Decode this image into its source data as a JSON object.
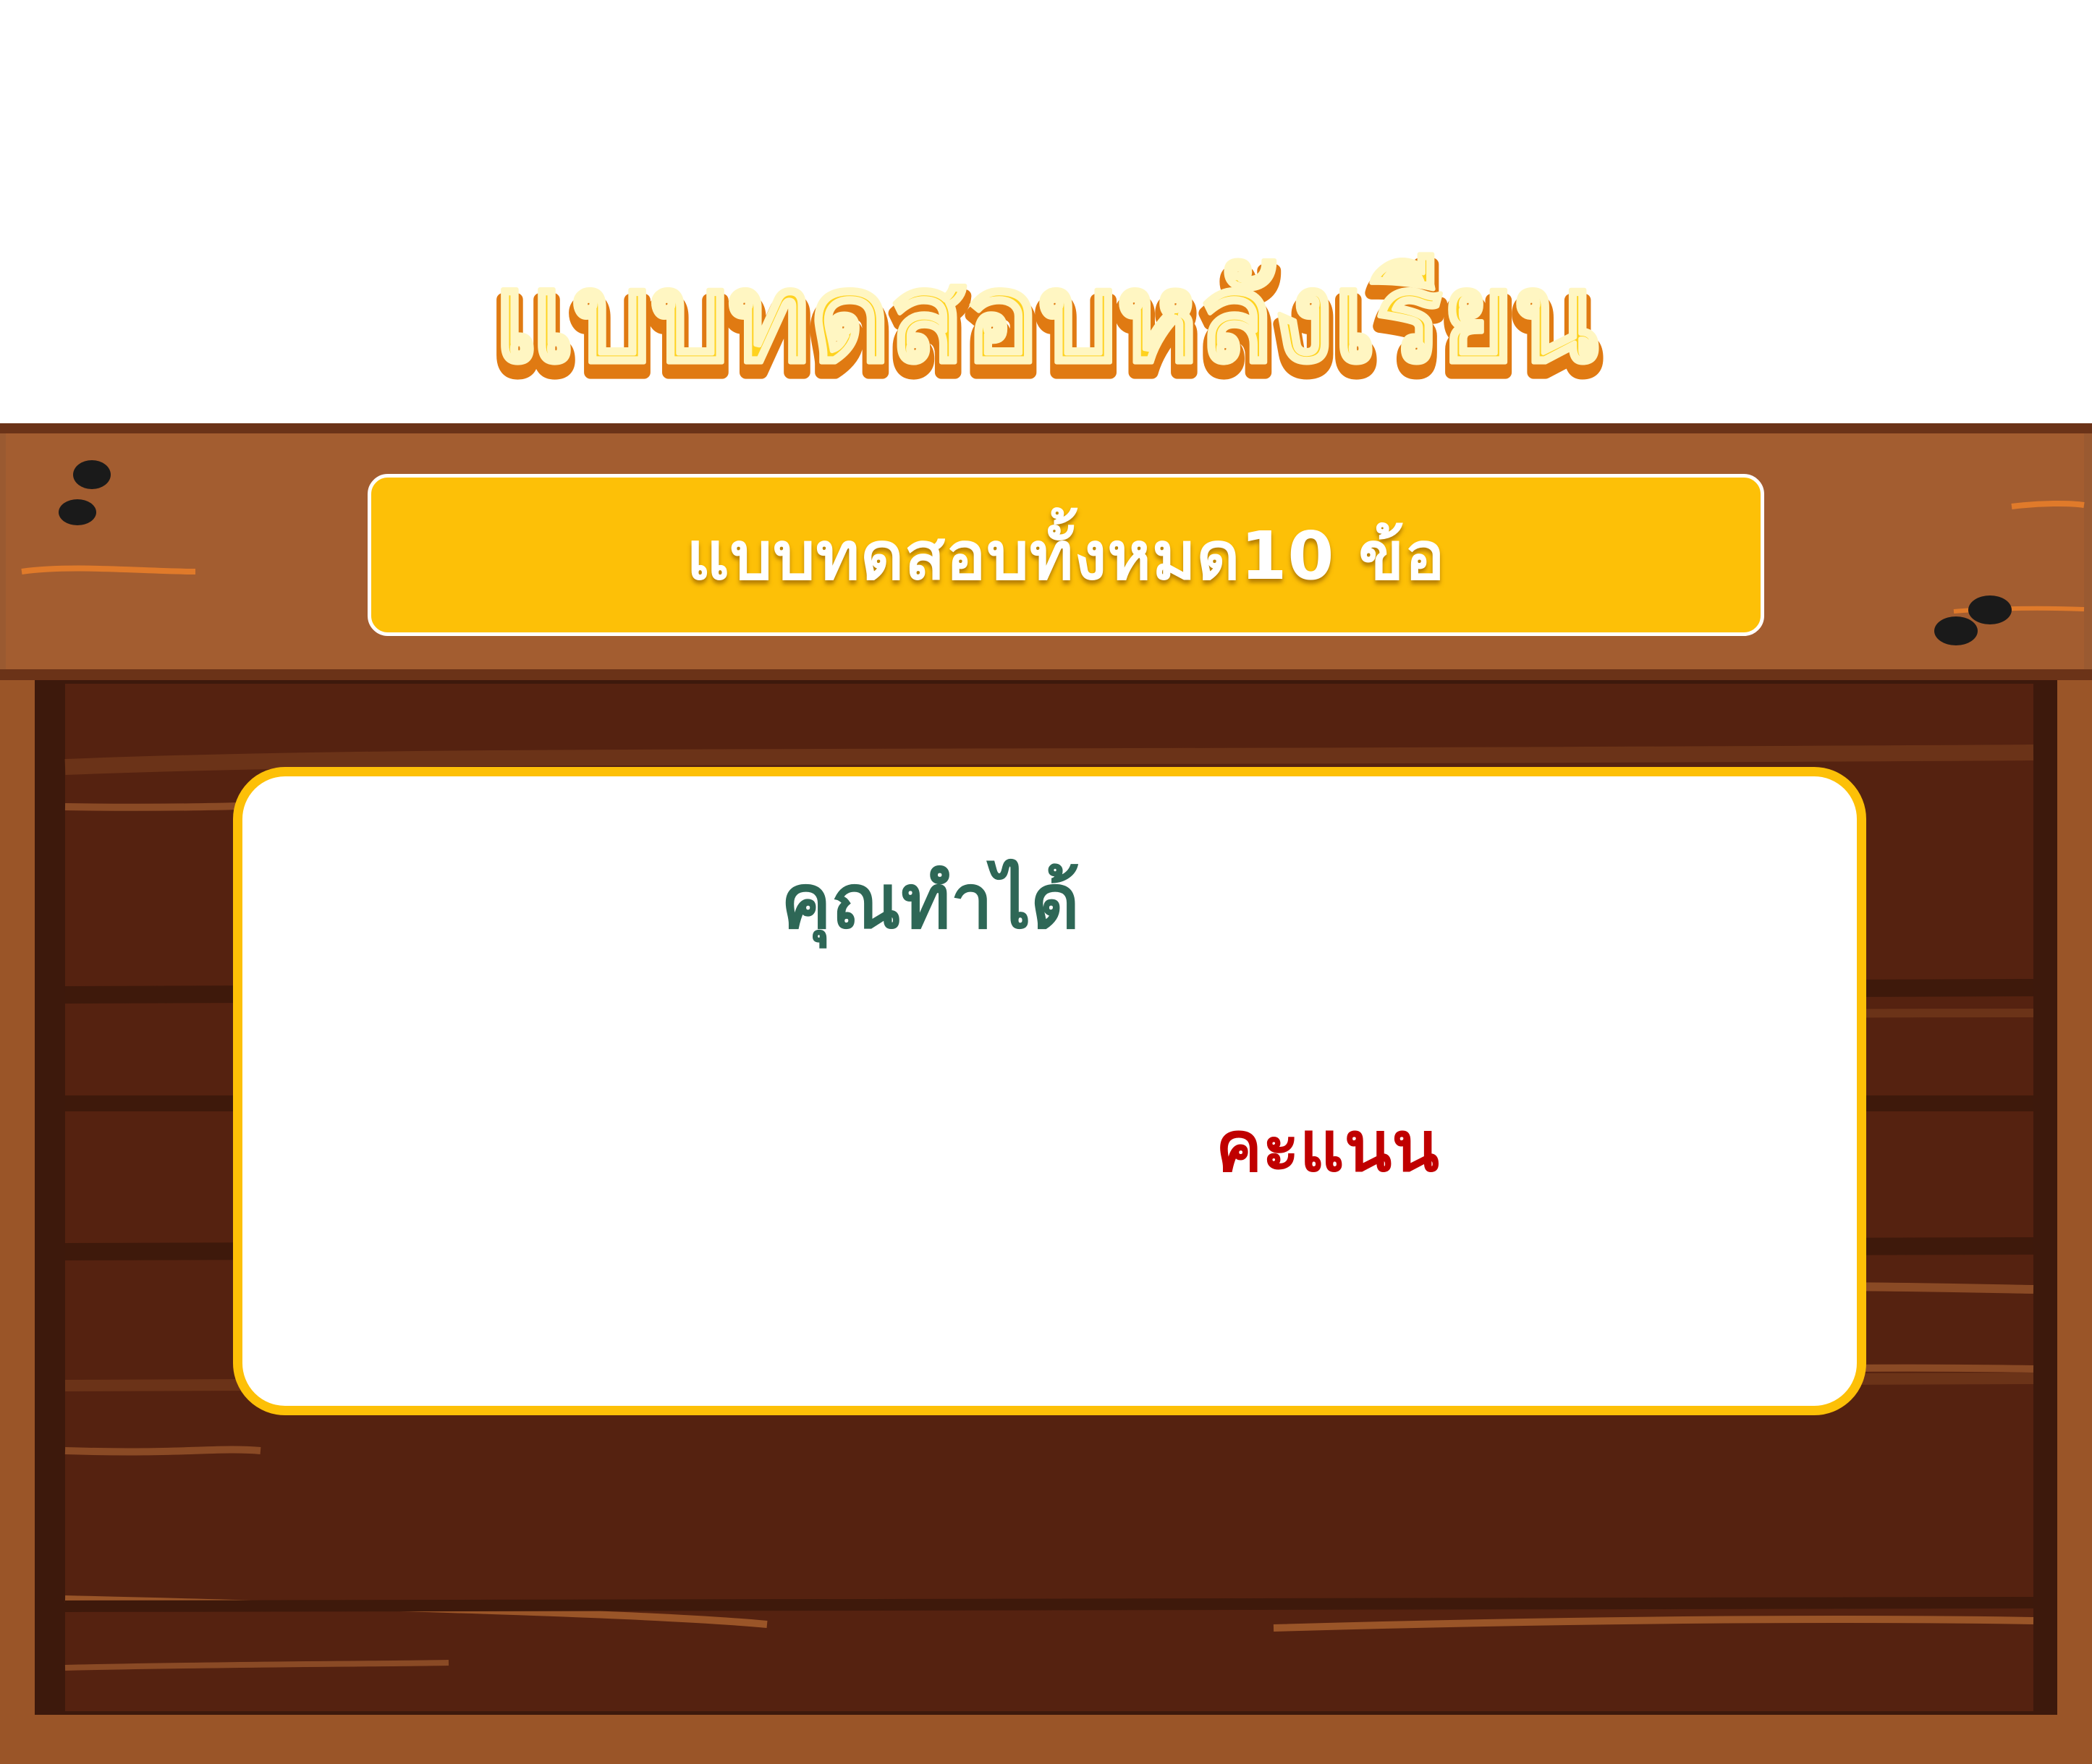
{
  "header": {
    "title": "แบบทดสอบหลังเรียน"
  },
  "banner": {
    "text": "แบบทดสอบทั้งหมด10 ข้อ"
  },
  "result": {
    "lead": "คุณทำได้",
    "score": "",
    "unit": "คะแนน"
  },
  "colors": {
    "title_fill": "#ffc91a",
    "title_outline": "#f59b1b",
    "banner_bg": "#fdc007",
    "card_border": "#fdc007",
    "lead_text": "#2e6756",
    "unit_text": "#c00000",
    "wood_light": "#a0592c",
    "wood_dark": "#552210"
  }
}
